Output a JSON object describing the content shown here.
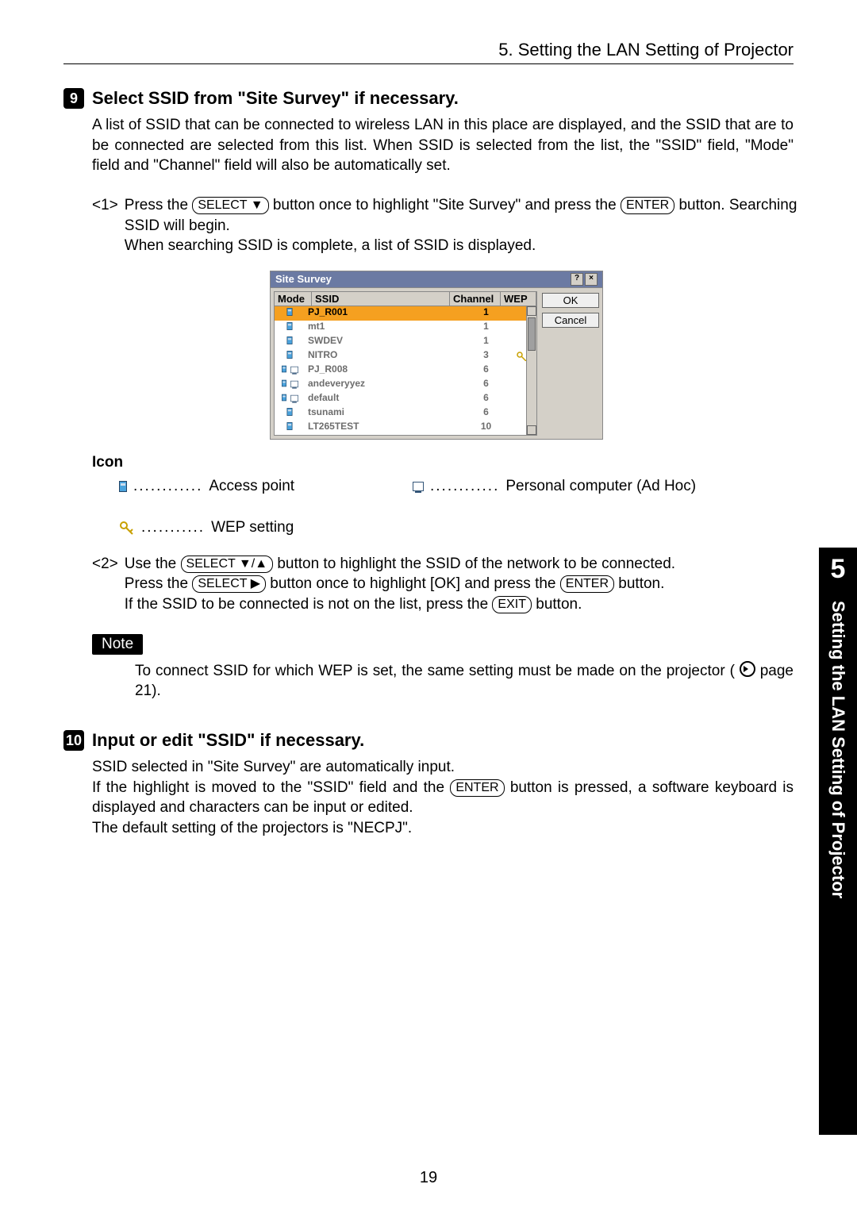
{
  "header": {
    "title": "5. Setting the LAN Setting of Projector"
  },
  "side_tab": {
    "num": "5",
    "text": "Setting the LAN Setting of Projector"
  },
  "page_number": "19",
  "step9": {
    "num": "9",
    "title": "Select SSID from \"Site Survey\" if necessary.",
    "intro": "A list of SSID that can be connected to wireless LAN in this place are displayed, and the SSID that are to be connected are selected from this list.  When SSID is selected from the list, the \"SSID\" field, \"Mode\" field and \"Channel\" field will also be automatically set."
  },
  "sub1": {
    "num": "<1>",
    "pre": "Press the ",
    "btn1": "SELECT",
    "mid1": " button once to highlight \"Site Survey\" and press the ",
    "btn2": "ENTER",
    "post1": " button. Searching SSID will begin.",
    "line3": "When searching SSID is complete, a list of SSID is displayed."
  },
  "site_survey": {
    "title": "Site Survey",
    "headers": {
      "mode": "Mode",
      "ssid": "SSID",
      "channel": "Channel",
      "wep": "WEP"
    },
    "rows": [
      {
        "mode": "ap",
        "ssid": "PJ_R001",
        "ch": "1",
        "wep": false,
        "selected": true
      },
      {
        "mode": "ap",
        "ssid": "mt1",
        "ch": "1",
        "wep": false,
        "selected": false
      },
      {
        "mode": "ap",
        "ssid": "SWDEV",
        "ch": "1",
        "wep": false,
        "selected": false
      },
      {
        "mode": "ap",
        "ssid": "NITRO",
        "ch": "3",
        "wep": true,
        "selected": false
      },
      {
        "mode": "pc",
        "ssid": "PJ_R008",
        "ch": "6",
        "wep": false,
        "selected": false
      },
      {
        "mode": "pc",
        "ssid": "andeveryyez",
        "ch": "6",
        "wep": false,
        "selected": false
      },
      {
        "mode": "pc",
        "ssid": "default",
        "ch": "6",
        "wep": false,
        "selected": false
      },
      {
        "mode": "ap",
        "ssid": "tsunami",
        "ch": "6",
        "wep": false,
        "selected": false
      },
      {
        "mode": "ap",
        "ssid": "LT265TEST",
        "ch": "10",
        "wep": false,
        "selected": false
      }
    ],
    "ok": "OK",
    "cancel": "Cancel"
  },
  "icons": {
    "heading": "Icon",
    "ap": "Access point",
    "pc": "Personal computer (Ad Hoc)",
    "wep": "WEP setting"
  },
  "sub2": {
    "num": "<2>",
    "l1a": "Use the ",
    "btn1": "SELECT",
    "l1b": " button to highlight the SSID of the network to be connected.",
    "l2a": "Press the ",
    "btn2": "SELECT",
    "l2b": " button once to highlight [OK] and press the ",
    "btn3": "ENTER",
    "l2c": " button.",
    "l3a": "If the SSID to be connected is not on the list, press the ",
    "btn4": "EXIT",
    "l3b": " button."
  },
  "note": {
    "label": "Note",
    "body_a": "To connect SSID for which WEP is set, the same setting must be made on the projector ( ",
    "body_b": " page 21)."
  },
  "step10": {
    "num": "10",
    "title": "Input or edit \"SSID\" if necessary.",
    "p1": "SSID selected in \"Site Survey\" are automatically input.",
    "p2a": "If the highlight is moved to the \"SSID\" field and the ",
    "btn": "ENTER",
    "p2b": " button is pressed, a software keyboard is displayed and characters can be input or edited.",
    "p3": "The default setting of the projectors is \"NECPJ\"."
  }
}
